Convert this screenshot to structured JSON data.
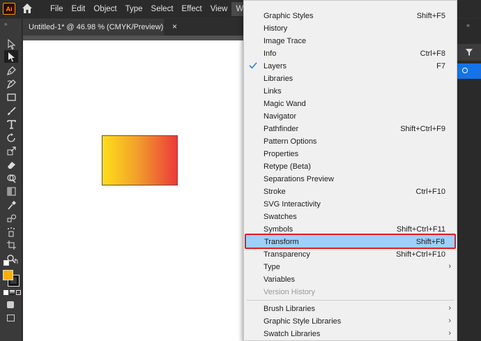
{
  "app": {
    "logo_text": "Ai",
    "accent_color": "#ff9a00"
  },
  "menubar": {
    "items": [
      {
        "label": "File"
      },
      {
        "label": "Edit"
      },
      {
        "label": "Object"
      },
      {
        "label": "Type"
      },
      {
        "label": "Select"
      },
      {
        "label": "Effect"
      },
      {
        "label": "View"
      },
      {
        "label": "Window",
        "active": true
      }
    ]
  },
  "document": {
    "tab_title": "Untitled-1* @ 46.98 % (CMYK/Preview)",
    "close_glyph": "×"
  },
  "toolbar": {
    "collapse_glyph": "»",
    "tools": [
      "selection-tool",
      "direct-selection-tool",
      "pen-tool",
      "curvature-tool",
      "rectangle-tool",
      "paintbrush-tool",
      "type-tool",
      "rotate-tool",
      "scale-tool",
      "eraser-tool",
      "shape-builder-tool",
      "gradient-tool",
      "eyedropper-tool",
      "blend-tool",
      "symbol-sprayer-tool",
      "artboard-tool",
      "zoom-tool"
    ],
    "selected_tool": "direct-selection-tool",
    "fill_color": "#ffb000",
    "stroke_color": "#000000"
  },
  "artwork": {
    "gradient_colors": [
      "#ffde1a",
      "#f2a22a",
      "#eb3a3a"
    ]
  },
  "window_menu": {
    "highlight_color": "#9fd0fb",
    "highlight_border": "#e31b23",
    "items": [
      {
        "label": "Graphic Styles",
        "shortcut": "Shift+F5"
      },
      {
        "label": "History",
        "shortcut": ""
      },
      {
        "label": "Image Trace",
        "shortcut": ""
      },
      {
        "label": "Info",
        "shortcut": "Ctrl+F8"
      },
      {
        "label": "Layers",
        "shortcut": "F7",
        "checked": true
      },
      {
        "label": "Libraries",
        "shortcut": ""
      },
      {
        "label": "Links",
        "shortcut": ""
      },
      {
        "label": "Magic Wand",
        "shortcut": ""
      },
      {
        "label": "Navigator",
        "shortcut": ""
      },
      {
        "label": "Pathfinder",
        "shortcut": "Shift+Ctrl+F9"
      },
      {
        "label": "Pattern Options",
        "shortcut": ""
      },
      {
        "label": "Properties",
        "shortcut": ""
      },
      {
        "label": "Retype (Beta)",
        "shortcut": ""
      },
      {
        "label": "Separations Preview",
        "shortcut": ""
      },
      {
        "label": "Stroke",
        "shortcut": "Ctrl+F10"
      },
      {
        "label": "SVG Interactivity",
        "shortcut": ""
      },
      {
        "label": "Swatches",
        "shortcut": ""
      },
      {
        "label": "Symbols",
        "shortcut": "Shift+Ctrl+F11"
      },
      {
        "label": "Transform",
        "shortcut": "Shift+F8",
        "highlighted": true
      },
      {
        "label": "Transparency",
        "shortcut": "Shift+Ctrl+F10"
      },
      {
        "label": "Type",
        "shortcut": "",
        "submenu": true
      },
      {
        "label": "Variables",
        "shortcut": ""
      },
      {
        "label": "Version History",
        "shortcut": "",
        "disabled": true
      },
      {
        "label": "Brush Libraries",
        "shortcut": "",
        "submenu": true
      },
      {
        "label": "Graphic Style Libraries",
        "shortcut": "",
        "submenu": true
      },
      {
        "label": "Swatch Libraries",
        "shortcut": "",
        "submenu": true
      }
    ],
    "check_glyph": "✓",
    "submenu_glyph": "›"
  }
}
